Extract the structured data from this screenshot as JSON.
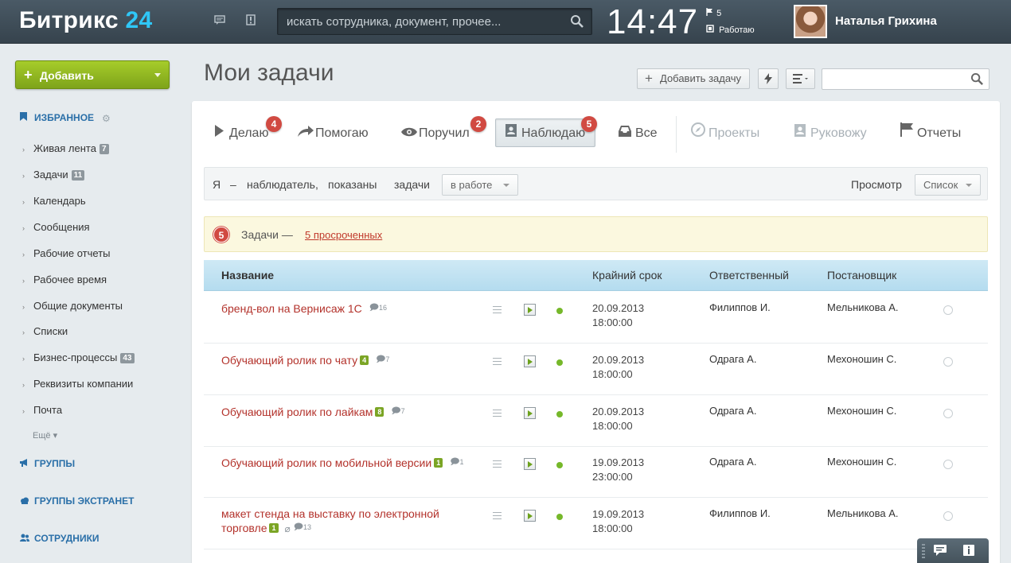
{
  "header": {
    "logo_main": "Битрикс",
    "logo_num": "24",
    "search_placeholder": "искать сотрудника, документ, прочее...",
    "clock": "14:47",
    "flag_count": "5",
    "status": "Работаю",
    "user_name": "Наталья Грихина"
  },
  "sidebar": {
    "add_button": "Добавить",
    "favorites": "ИЗБРАННОЕ",
    "items": [
      {
        "label": "Живая лента",
        "count": "7"
      },
      {
        "label": "Задачи",
        "count": "11"
      },
      {
        "label": "Календарь",
        "count": ""
      },
      {
        "label": "Сообщения",
        "count": ""
      },
      {
        "label": "Рабочие отчеты",
        "count": ""
      },
      {
        "label": "Рабочее время",
        "count": ""
      },
      {
        "label": "Общие документы",
        "count": ""
      },
      {
        "label": "Списки",
        "count": ""
      },
      {
        "label": "Бизнес-процессы",
        "count": "43"
      },
      {
        "label": "Реквизиты компании",
        "count": ""
      },
      {
        "label": "Почта",
        "count": ""
      }
    ],
    "more": "Ещё",
    "groups": "ГРУППЫ",
    "extranet": "ГРУППЫ ЭКСТРАНЕТ",
    "employees": "СОТРУДНИКИ"
  },
  "main": {
    "title": "Мои задачи",
    "add_task": "Добавить задачу"
  },
  "tabs": [
    {
      "label": "Делаю",
      "badge": "4"
    },
    {
      "label": "Помогаю",
      "badge": ""
    },
    {
      "label": "Поручил",
      "badge": "2"
    },
    {
      "label": "Наблюдаю",
      "badge": "5"
    },
    {
      "label": "Все",
      "badge": ""
    },
    {
      "label": "Проекты",
      "badge": ""
    },
    {
      "label": "Руковожу",
      "badge": ""
    },
    {
      "label": "Отчеты",
      "badge": ""
    }
  ],
  "filter": {
    "w1": "Я",
    "w2": "–",
    "w3": "наблюдатель,",
    "w4": "показаны",
    "w5": "задачи",
    "status": "в работе",
    "view_label": "Просмотр",
    "view_value": "Список"
  },
  "notice": {
    "badge": "5",
    "text": "Задачи —",
    "link": "5 просроченных"
  },
  "table": {
    "headers": {
      "name": "Название",
      "deadline": "Крайний срок",
      "responsible": "Ответственный",
      "author": "Постановщик"
    },
    "rows": [
      {
        "title": "бренд-вол на Вернисаж 1С",
        "count": "",
        "comments": "16",
        "clip": false,
        "date": "20.09.2013",
        "time": "18:00:00",
        "responsible": "Филиппов И.",
        "author": "Мельникова А."
      },
      {
        "title": "Обучающий ролик по чату",
        "count": "4",
        "comments": "7",
        "clip": false,
        "date": "20.09.2013",
        "time": "18:00:00",
        "responsible": "Одрага А.",
        "author": "Мехоношин С."
      },
      {
        "title": "Обучающий ролик по лайкам",
        "count": "8",
        "comments": "7",
        "clip": false,
        "date": "20.09.2013",
        "time": "18:00:00",
        "responsible": "Одрага А.",
        "author": "Мехоношин С."
      },
      {
        "title": "Обучающий ролик по мобильной версии",
        "count": "1",
        "comments": "1",
        "clip": false,
        "date": "19.09.2013",
        "time": "23:00:00",
        "responsible": "Одрага А.",
        "author": "Мехоношин С."
      },
      {
        "title": "макет стенда на выставку по электронной торговле",
        "count": "1",
        "comments": "13",
        "clip": true,
        "date": "19.09.2013",
        "time": "18:00:00",
        "responsible": "Филиппов И.",
        "author": "Мельникова А."
      }
    ]
  },
  "colors": {
    "header_bg": "#3f4d57",
    "accent_blue": "#2fc7f7",
    "add_green": "#8db822",
    "task_red": "#b3322b",
    "badge_red": "#d14a42",
    "status_green": "#76b82a"
  }
}
